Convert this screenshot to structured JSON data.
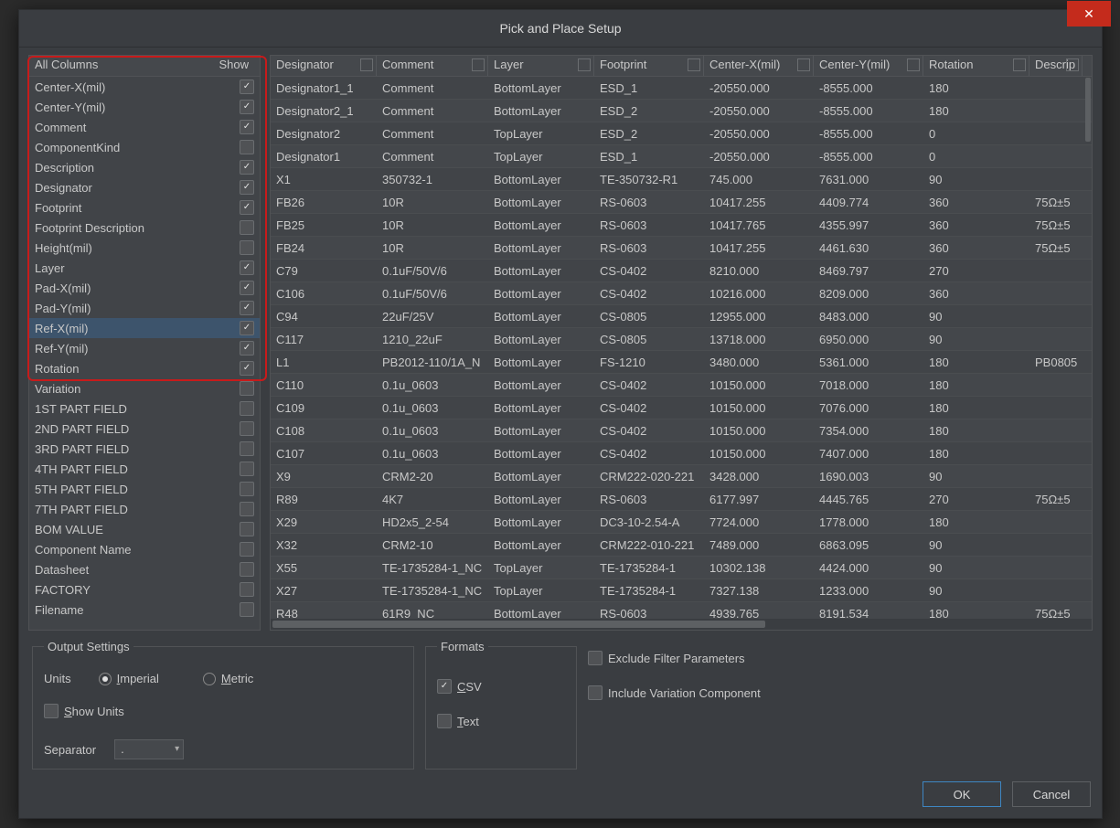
{
  "title": "Pick and Place Setup",
  "close_label": "✕",
  "left": {
    "header_col": "All Columns",
    "header_show": "Show",
    "selected_index": 12,
    "rows": [
      {
        "label": "Center-X(mil)",
        "checked": true,
        "annotated": true
      },
      {
        "label": "Center-Y(mil)",
        "checked": true,
        "annotated": true
      },
      {
        "label": "Comment",
        "checked": true,
        "annotated": true
      },
      {
        "label": "ComponentKind",
        "checked": false,
        "annotated": true
      },
      {
        "label": "Description",
        "checked": true,
        "annotated": true
      },
      {
        "label": "Designator",
        "checked": true,
        "annotated": true
      },
      {
        "label": "Footprint",
        "checked": true,
        "annotated": true
      },
      {
        "label": "Footprint Description",
        "checked": false,
        "annotated": true
      },
      {
        "label": "Height(mil)",
        "checked": false,
        "annotated": true
      },
      {
        "label": "Layer",
        "checked": true,
        "annotated": true
      },
      {
        "label": "Pad-X(mil)",
        "checked": true,
        "annotated": true
      },
      {
        "label": "Pad-Y(mil)",
        "checked": true,
        "annotated": true
      },
      {
        "label": "Ref-X(mil)",
        "checked": true,
        "annotated": true
      },
      {
        "label": "Ref-Y(mil)",
        "checked": true,
        "annotated": true
      },
      {
        "label": "Rotation",
        "checked": true,
        "annotated": true
      },
      {
        "label": "Variation",
        "checked": false,
        "annotated": false
      },
      {
        "label": "1ST PART FIELD",
        "checked": false,
        "annotated": false
      },
      {
        "label": "2ND PART FIELD",
        "checked": false,
        "annotated": false
      },
      {
        "label": "3RD PART FIELD",
        "checked": false,
        "annotated": false
      },
      {
        "label": "4TH PART FIELD",
        "checked": false,
        "annotated": false
      },
      {
        "label": "5TH PART FIELD",
        "checked": false,
        "annotated": false
      },
      {
        "label": "7TH PART FIELD",
        "checked": false,
        "annotated": false
      },
      {
        "label": "BOM VALUE",
        "checked": false,
        "annotated": false
      },
      {
        "label": "Component Name",
        "checked": false,
        "annotated": false
      },
      {
        "label": "Datasheet",
        "checked": false,
        "annotated": false
      },
      {
        "label": "FACTORY",
        "checked": false,
        "annotated": false
      },
      {
        "label": "Filename",
        "checked": false,
        "annotated": false
      }
    ]
  },
  "grid": {
    "columns": [
      "Designator",
      "Comment",
      "Layer",
      "Footprint",
      "Center-X(mil)",
      "Center-Y(mil)",
      "Rotation",
      "Descrip"
    ],
    "rows": [
      [
        "Designator1_1",
        "Comment",
        "BottomLayer",
        "ESD_1",
        "-20550.000",
        "-8555.000",
        "180",
        ""
      ],
      [
        "Designator2_1",
        "Comment",
        "BottomLayer",
        "ESD_2",
        "-20550.000",
        "-8555.000",
        "180",
        ""
      ],
      [
        "Designator2",
        "Comment",
        "TopLayer",
        "ESD_2",
        "-20550.000",
        "-8555.000",
        "0",
        ""
      ],
      [
        "Designator1",
        "Comment",
        "TopLayer",
        "ESD_1",
        "-20550.000",
        "-8555.000",
        "0",
        ""
      ],
      [
        "X1",
        "350732-1",
        "BottomLayer",
        "TE-350732-R1",
        "745.000",
        "7631.000",
        "90",
        ""
      ],
      [
        "FB26",
        "10R",
        "BottomLayer",
        "RS-0603",
        "10417.255",
        "4409.774",
        "360",
        "75Ω±5"
      ],
      [
        "FB25",
        "10R",
        "BottomLayer",
        "RS-0603",
        "10417.765",
        "4355.997",
        "360",
        "75Ω±5"
      ],
      [
        "FB24",
        "10R",
        "BottomLayer",
        "RS-0603",
        "10417.255",
        "4461.630",
        "360",
        "75Ω±5"
      ],
      [
        "C79",
        "0.1uF/50V/6",
        "BottomLayer",
        "CS-0402",
        "8210.000",
        "8469.797",
        "270",
        ""
      ],
      [
        "C106",
        "0.1uF/50V/6",
        "BottomLayer",
        "CS-0402",
        "10216.000",
        "8209.000",
        "360",
        ""
      ],
      [
        "C94",
        "22uF/25V",
        "BottomLayer",
        "CS-0805",
        "12955.000",
        "8483.000",
        "90",
        ""
      ],
      [
        "C117",
        "1210_22uF",
        "BottomLayer",
        "CS-0805",
        "13718.000",
        "6950.000",
        "90",
        ""
      ],
      [
        "L1",
        "PB2012-110/1A_N",
        "BottomLayer",
        "FS-1210",
        "3480.000",
        "5361.000",
        "180",
        "PB0805"
      ],
      [
        "C110",
        "0.1u_0603",
        "BottomLayer",
        "CS-0402",
        "10150.000",
        "7018.000",
        "180",
        ""
      ],
      [
        "C109",
        "0.1u_0603",
        "BottomLayer",
        "CS-0402",
        "10150.000",
        "7076.000",
        "180",
        ""
      ],
      [
        "C108",
        "0.1u_0603",
        "BottomLayer",
        "CS-0402",
        "10150.000",
        "7354.000",
        "180",
        ""
      ],
      [
        "C107",
        "0.1u_0603",
        "BottomLayer",
        "CS-0402",
        "10150.000",
        "7407.000",
        "180",
        ""
      ],
      [
        "X9",
        "CRM2-20",
        "BottomLayer",
        "CRM222-020-221",
        "3428.000",
        "1690.003",
        "90",
        ""
      ],
      [
        "R89",
        "4K7",
        "BottomLayer",
        "RS-0603",
        "6177.997",
        "4445.765",
        "270",
        "75Ω±5"
      ],
      [
        "X29",
        "HD2x5_2-54",
        "BottomLayer",
        "DC3-10-2.54-A",
        "7724.000",
        "1778.000",
        "180",
        ""
      ],
      [
        "X32",
        "CRM2-10",
        "BottomLayer",
        "CRM222-010-221",
        "7489.000",
        "6863.095",
        "90",
        ""
      ],
      [
        "X55",
        "TE-1735284-1_NC",
        "TopLayer",
        "TE-1735284-1",
        "10302.138",
        "4424.000",
        "90",
        ""
      ],
      [
        "X27",
        "TE-1735284-1_NC",
        "TopLayer",
        "TE-1735284-1",
        "7327.138",
        "1233.000",
        "90",
        ""
      ],
      [
        "R48",
        "61R9_NC",
        "BottomLayer",
        "RS-0603",
        "4939.765",
        "8191.534",
        "180",
        "75Ω±5"
      ]
    ]
  },
  "output": {
    "legend": "Output Settings",
    "units_label": "Units",
    "imperial_label": "Imperial",
    "metric_label": "Metric",
    "imperial_on": true,
    "show_units_label": "Show Units",
    "show_units_on": false,
    "separator_label": "Separator",
    "separator_value": "."
  },
  "formats": {
    "legend": "Formats",
    "csv_label": "CSV",
    "csv_on": true,
    "text_label": "Text",
    "text_on": false
  },
  "extras": {
    "exclude_label": "Exclude Filter Parameters",
    "exclude_on": false,
    "include_label": "Include Variation Component",
    "include_on": false
  },
  "buttons": {
    "ok": "OK",
    "cancel": "Cancel"
  }
}
